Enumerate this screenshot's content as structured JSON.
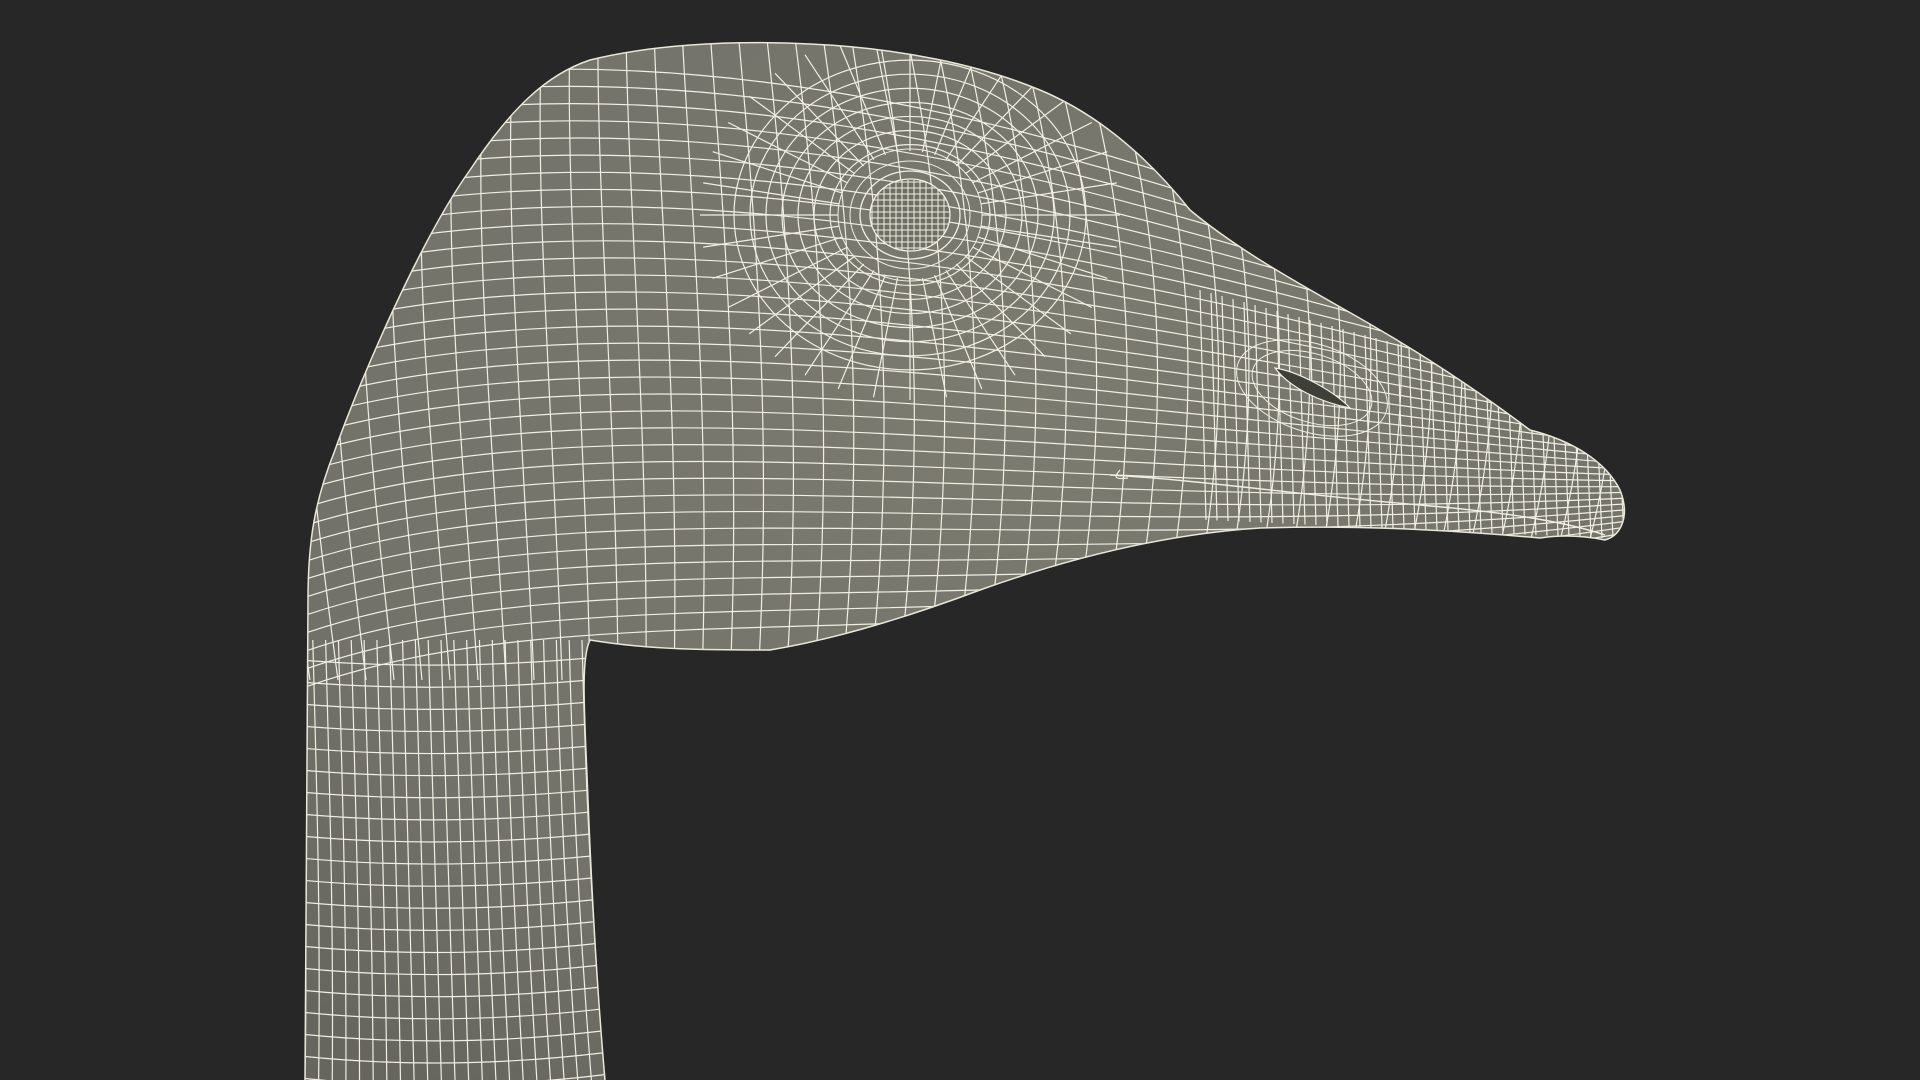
{
  "scene": {
    "subject": "goose-head-wireframe",
    "background_color": "#272727",
    "surface_color": "#75756a",
    "wire_color": "#f0efe2",
    "shading_color": "#5f5f56"
  }
}
